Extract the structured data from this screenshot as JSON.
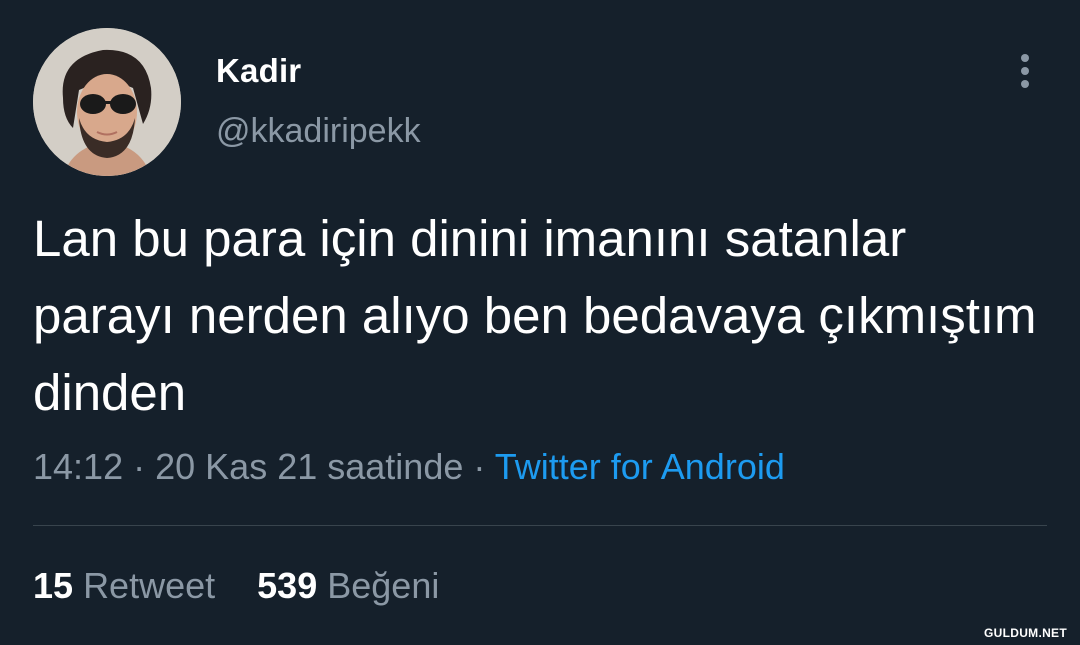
{
  "tweet": {
    "author": {
      "name": "Kadir",
      "handle": "@kkadiripekk"
    },
    "text": "Lan bu para için dinini imanını satanlar parayı nerden alıyo ben bedavaya çıkmıştım dinden",
    "time": "14:12",
    "separator": "·",
    "date": "20 Kas 21 saatinde",
    "source": "Twitter for Android",
    "retweets": {
      "count": "15",
      "label": "Retweet"
    },
    "likes": {
      "count": "539",
      "label": "Beğeni"
    }
  },
  "watermark": "GULDUM.NET",
  "icons": {
    "more": "more-vertical-icon",
    "avatar": "profile-photo"
  },
  "colors": {
    "background": "#15202b",
    "primary_text": "#ffffff",
    "secondary_text": "#8b98a5",
    "link": "#1d9bf0",
    "divider": "#38444d"
  }
}
